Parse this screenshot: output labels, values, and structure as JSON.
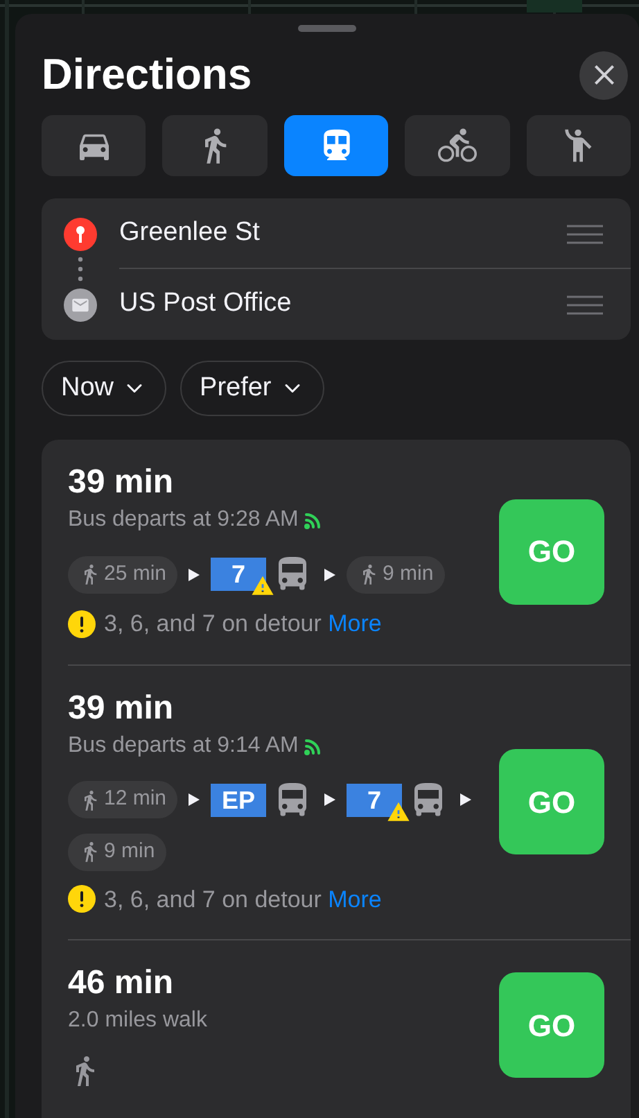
{
  "title": "Directions",
  "modes": [
    {
      "kind": "car",
      "selected": false
    },
    {
      "kind": "walk",
      "selected": false
    },
    {
      "kind": "transit",
      "selected": true
    },
    {
      "kind": "cycle",
      "selected": false
    },
    {
      "kind": "rideshare",
      "selected": false
    }
  ],
  "stops": [
    {
      "kind": "origin",
      "name": "Greenlee St"
    },
    {
      "kind": "destination",
      "name": "US Post Office"
    }
  ],
  "filters": [
    {
      "label": "Now"
    },
    {
      "label": "Prefer"
    }
  ],
  "routes": [
    {
      "duration": "39 min",
      "subtitle": "Bus departs at 9:28 AM",
      "live": true,
      "button": "GO",
      "steps": [
        {
          "kind": "walk",
          "label": "25 min"
        },
        {
          "kind": "arrow"
        },
        {
          "kind": "bus",
          "line": "7",
          "warning": true
        },
        {
          "kind": "arrow"
        },
        {
          "kind": "walk",
          "label": "9 min"
        }
      ],
      "alert": {
        "text": "3, 6, and 7 on detour",
        "link": "More"
      }
    },
    {
      "duration": "39 min",
      "subtitle": "Bus departs at 9:14 AM",
      "live": true,
      "button": "GO",
      "steps": [
        {
          "kind": "walk",
          "label": "12 min"
        },
        {
          "kind": "arrow"
        },
        {
          "kind": "bus",
          "line": "EP",
          "warning": false
        },
        {
          "kind": "arrow"
        },
        {
          "kind": "bus",
          "line": "7",
          "warning": true
        },
        {
          "kind": "arrow"
        },
        {
          "kind": "walk",
          "label": "9 min"
        }
      ],
      "alert": {
        "text": "3, 6, and 7 on detour",
        "link": "More"
      }
    },
    {
      "duration": "46 min",
      "subtitle": "2.0 miles walk",
      "live": false,
      "button": "GO",
      "steps": [
        {
          "kind": "walk_icon"
        }
      ]
    }
  ]
}
